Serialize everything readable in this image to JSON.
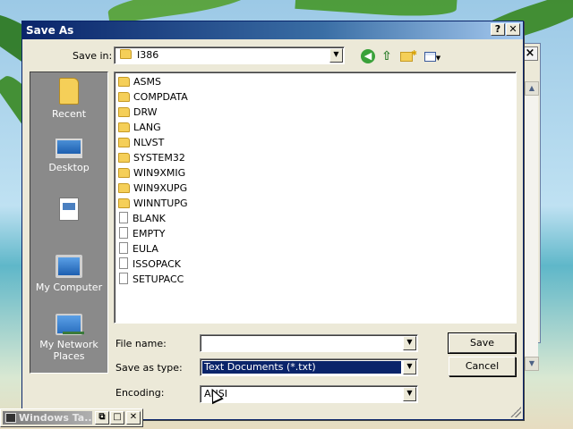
{
  "dialog": {
    "title": "Save As",
    "help_glyph": "?",
    "close_glyph": "✕"
  },
  "save_in": {
    "label": "Save in:",
    "value": "I386"
  },
  "places": [
    {
      "label": "Recent",
      "icon": "recent-folder-icon"
    },
    {
      "label": "Desktop",
      "icon": "desktop-icon"
    },
    {
      "label": "",
      "icon": "my-documents-icon"
    },
    {
      "label": "My Computer",
      "icon": "my-computer-icon"
    },
    {
      "label": "My Network Places",
      "icon": "network-places-icon"
    }
  ],
  "files": [
    {
      "name": "ASMS",
      "type": "folder"
    },
    {
      "name": "COMPDATA",
      "type": "folder"
    },
    {
      "name": "DRW",
      "type": "folder"
    },
    {
      "name": "LANG",
      "type": "folder"
    },
    {
      "name": "NLVST",
      "type": "folder"
    },
    {
      "name": "SYSTEM32",
      "type": "folder"
    },
    {
      "name": "WIN9XMIG",
      "type": "folder"
    },
    {
      "name": "WIN9XUPG",
      "type": "folder"
    },
    {
      "name": "WINNTUPG",
      "type": "folder"
    },
    {
      "name": "BLANK",
      "type": "file"
    },
    {
      "name": "EMPTY",
      "type": "file"
    },
    {
      "name": "EULA",
      "type": "file"
    },
    {
      "name": "ISSOPACK",
      "type": "file"
    },
    {
      "name": "SETUPACC",
      "type": "file"
    }
  ],
  "fields": {
    "file_name_label": "File name:",
    "file_name_value": "",
    "save_as_type_label": "Save as type:",
    "save_as_type_value": "Text Documents (*.txt)",
    "encoding_label": "Encoding:",
    "encoding_value": "ANSI"
  },
  "buttons": {
    "save": "Save",
    "cancel": "Cancel"
  },
  "taskbar": {
    "minimized_title": "Windows Ta..."
  },
  "colors": {
    "title_bar": "#0a246a",
    "selection": "#0a246a",
    "dialog_face": "#ece9d8"
  }
}
